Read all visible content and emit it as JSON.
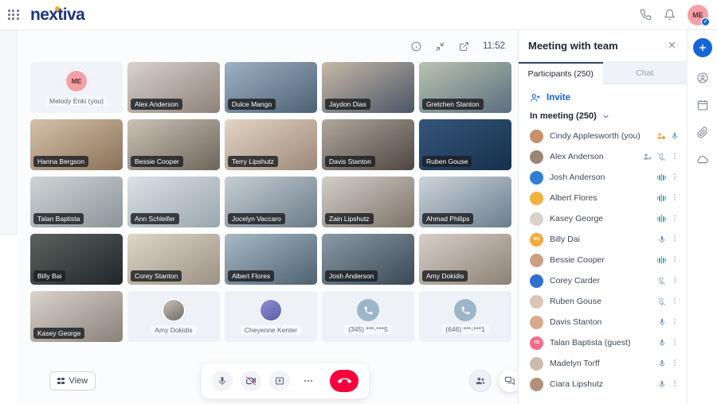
{
  "topbar": {
    "brand": "nextiva",
    "menu_icon": "grid-apps-icon",
    "phone_icon": "phone-icon",
    "bell_icon": "bell-icon",
    "avatar_initials": "ME",
    "avatar_status": "available-check"
  },
  "stage": {
    "info_icon": "info-icon",
    "collapse_icon": "collapse-arrows-icon",
    "popout_icon": "open-external-icon",
    "clock": "11:52"
  },
  "tiles": [
    {
      "name": "Melody Enki (you)",
      "kind": "self",
      "initials": "ME"
    },
    {
      "name": "Alex Anderson",
      "kind": "video",
      "c1": "#d8d3cd",
      "c2": "#8e8279"
    },
    {
      "name": "Dulce Mango",
      "kind": "video",
      "c1": "#9fb2c4",
      "c2": "#4d6175"
    },
    {
      "name": "Jaydon Dias",
      "kind": "video",
      "c1": "#c7b9a8",
      "c2": "#4a5566"
    },
    {
      "name": "Gretchen Stanton",
      "kind": "video",
      "c1": "#b9c4b0",
      "c2": "#5c6d7e"
    },
    {
      "name": "Hanna Bergson",
      "kind": "video",
      "c1": "#d5c2ab",
      "c2": "#8b7158"
    },
    {
      "name": "Bessie Cooper",
      "kind": "video",
      "c1": "#ccc3b7",
      "c2": "#6d645a"
    },
    {
      "name": "Terry Lipshutz",
      "kind": "video",
      "c1": "#e2d5c6",
      "c2": "#9d8878"
    },
    {
      "name": "Davis Stanton",
      "kind": "video",
      "c1": "#b0a79c",
      "c2": "#4e4741"
    },
    {
      "name": "Ruben Gouse",
      "kind": "video",
      "c1": "#35567a",
      "c2": "#16304d"
    },
    {
      "name": "Talan Baptista",
      "kind": "video",
      "c1": "#cfd4d6",
      "c2": "#8c9499"
    },
    {
      "name": "Ann Schleifer",
      "kind": "video",
      "c1": "#dbe1e6",
      "c2": "#9aa6ae"
    },
    {
      "name": "Jocelyn Vaccaro",
      "kind": "video",
      "c1": "#c6cfd6",
      "c2": "#6c7b87"
    },
    {
      "name": "Zain Lipshutz",
      "kind": "video",
      "c1": "#d2cfc9",
      "c2": "#7d7468"
    },
    {
      "name": "Ahmad Philips",
      "kind": "video",
      "c1": "#cdd4da",
      "c2": "#6a7d8e"
    },
    {
      "name": "Billy Bai",
      "kind": "video",
      "c1": "#5d625f",
      "c2": "#20262a"
    },
    {
      "name": "Corey Stanton",
      "kind": "video",
      "c1": "#ddd6c9",
      "c2": "#9c9283"
    },
    {
      "name": "Albert Flores",
      "kind": "video",
      "c1": "#a9bac6",
      "c2": "#4e6170"
    },
    {
      "name": "Josh Anderson",
      "kind": "video",
      "c1": "#8d9aa6",
      "c2": "#3a4855"
    },
    {
      "name": "Amy Dokidis",
      "kind": "video",
      "c1": "#d7cfc6",
      "c2": "#8d8177"
    },
    {
      "name": "Kasey George",
      "kind": "video",
      "c1": "#d9d4cd",
      "c2": "#8a8179"
    },
    {
      "name": "Amy Dokidis",
      "kind": "avatar",
      "c1": "#c9c2ba",
      "c2": "#6f6a64"
    },
    {
      "name": "Cheyenne Kenter",
      "kind": "avatar",
      "c1": "#8c8fd4",
      "c2": "#5b5fa8"
    },
    {
      "name": "(345) ***-***5",
      "kind": "phone",
      "icon": "phone-icon"
    },
    {
      "name": "(646) ***-***1",
      "kind": "phone",
      "icon": "phone-icon"
    }
  ],
  "controls": {
    "view_label": "View",
    "view_icon": "grid-view-icon",
    "mic_icon": "microphone-icon",
    "camera_icon": "camera-off-icon",
    "share_icon": "share-screen-icon",
    "more_icon": "more-options-icon",
    "hangup_icon": "end-call-icon",
    "participants_icon": "participants-icon",
    "chat_icon": "chat-icon"
  },
  "panel": {
    "title": "Meeting with team",
    "close_icon": "close-icon",
    "tabs": [
      {
        "label": "Participants (250)",
        "active": true
      },
      {
        "label": "Chat",
        "active": false
      }
    ],
    "invite_label": "Invite",
    "invite_icon": "add-person-icon",
    "section_label": "In meeting (250)",
    "section_chevron": "chevron-down-icon",
    "participants": [
      {
        "name": "Cindy Applesworth (you)",
        "av": "#c98f6a",
        "initials": "",
        "icons": [
          "host",
          "mic"
        ]
      },
      {
        "name": "Alex Anderson",
        "av": "#9a8574",
        "initials": "",
        "icons": [
          "cohost",
          "mic-off",
          "kebab"
        ]
      },
      {
        "name": "Josh Anderson",
        "av": "#2f7fd6",
        "initials": "",
        "icons": [
          "wave",
          "kebab"
        ]
      },
      {
        "name": "Albert Flores",
        "av": "#f0b23c",
        "initials": "",
        "icons": [
          "wave",
          "kebab"
        ]
      },
      {
        "name": "Kasey George",
        "av": "#d8d2cb",
        "initials": "",
        "icons": [
          "wave",
          "kebab"
        ]
      },
      {
        "name": "Billy Dai",
        "av": "#f5a83c",
        "initials": "BD",
        "icons": [
          "mic",
          "kebab"
        ]
      },
      {
        "name": "Bessie Cooper",
        "av": "#c9a184",
        "initials": "",
        "icons": [
          "wave",
          "kebab"
        ]
      },
      {
        "name": "Corey Carder",
        "av": "#2f6fd0",
        "initials": "",
        "icons": [
          "mic-off",
          "kebab"
        ]
      },
      {
        "name": "Ruben Gouse",
        "av": "#d9c6b6",
        "initials": "",
        "icons": [
          "mic-off",
          "kebab"
        ]
      },
      {
        "name": "Davis Stanton",
        "av": "#d8a98c",
        "initials": "",
        "icons": [
          "mic",
          "kebab"
        ]
      },
      {
        "name": "Talan Baptista (guest)",
        "av": "#f56a8a",
        "initials": "TB",
        "icons": [
          "mic",
          "kebab"
        ]
      },
      {
        "name": "Madelyn Torff",
        "av": "#cbbcae",
        "initials": "",
        "icons": [
          "mic",
          "kebab"
        ]
      },
      {
        "name": "Ciara Lipshutz",
        "av": "#b3907a",
        "initials": "",
        "icons": [
          "mic",
          "kebab"
        ]
      }
    ]
  },
  "rail": {
    "plus_icon": "add-icon",
    "items": [
      "contacts-icon",
      "calendar-icon",
      "attachment-icon",
      "cloud-icon"
    ]
  }
}
